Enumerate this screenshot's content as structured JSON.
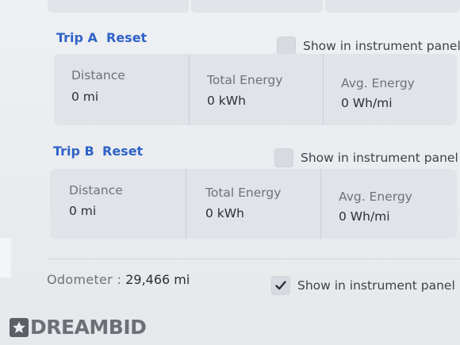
{
  "trips": [
    {
      "title": "Trip A",
      "reset_label": "Reset",
      "show_panel": {
        "label": "Show in instrument panel",
        "checked": false
      },
      "stats": [
        {
          "label": "Distance",
          "value": "0 mi"
        },
        {
          "label": "Total Energy",
          "value": "0 kWh"
        },
        {
          "label": "Avg. Energy",
          "value": "0 Wh/mi"
        }
      ]
    },
    {
      "title": "Trip B",
      "reset_label": "Reset",
      "show_panel": {
        "label": "Show in instrument panel",
        "checked": false
      },
      "stats": [
        {
          "label": "Distance",
          "value": "0 mi"
        },
        {
          "label": "Total Energy",
          "value": "0 kWh"
        },
        {
          "label": "Avg. Energy",
          "value": "0 Wh/mi"
        }
      ]
    }
  ],
  "odometer": {
    "label": "Odometer  :",
    "value": "29,466 mi",
    "show_panel": {
      "label": "Show in instrument panel",
      "checked": true
    }
  },
  "watermark": {
    "text": "DREAMBID",
    "icon": "star-icon"
  },
  "colors": {
    "link": "#2f63c7",
    "cell_bg": "#e0e3e8",
    "panel_bg": "#eceef1"
  }
}
